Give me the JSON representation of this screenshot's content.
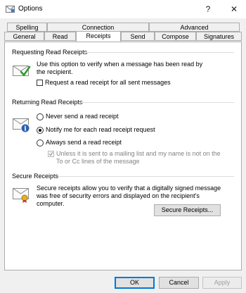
{
  "window": {
    "title": "Options",
    "help": "?",
    "close": "✕"
  },
  "tabs_row1": [
    "Spelling",
    "Connection",
    "Advanced"
  ],
  "tabs_row2": [
    "General",
    "Read",
    "Receipts",
    "Send",
    "Compose",
    "Signatures"
  ],
  "requesting": {
    "title": "Requesting Read Receipts",
    "desc": "Use this option to verify when a message has been read by the recipient.",
    "checkbox_label": "Request a read receipt for all sent messages"
  },
  "returning": {
    "title": "Returning Read Receipts",
    "never": "Never send a read receipt",
    "notify": "Notify me for each read receipt request",
    "always": "Always send a read receipt",
    "unless": "Unless it is sent to a mailing list and my name is not on the To or Cc lines of the message"
  },
  "secure": {
    "title": "Secure Receipts",
    "desc": "Secure receipts allow you to verify that a digitally signed message was free of security errors and displayed on the recipient's computer.",
    "button": "Secure Receipts..."
  },
  "footer": {
    "ok": "OK",
    "cancel": "Cancel",
    "apply": "Apply"
  },
  "colors": {
    "accent": "#0078d7",
    "check_green": "#2e9c2e"
  }
}
